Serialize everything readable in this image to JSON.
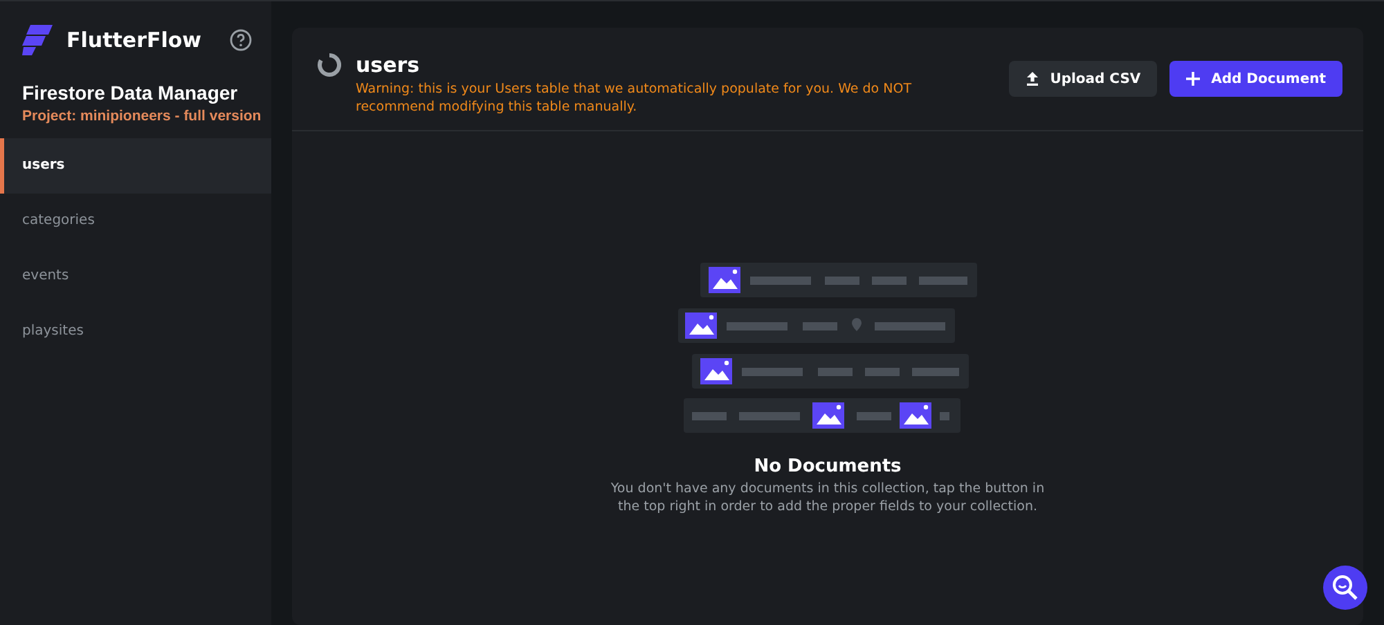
{
  "brand": {
    "name": "FlutterFlow"
  },
  "sidebar": {
    "title": "Firestore Data Manager",
    "project": "Project: minipioneers - full version",
    "items": [
      {
        "label": "users",
        "selected": true
      },
      {
        "label": "categories",
        "selected": false
      },
      {
        "label": "events",
        "selected": false
      },
      {
        "label": "playsites",
        "selected": false
      }
    ]
  },
  "collection": {
    "title": "users",
    "warning": "Warning: this is your Users table that we automatically populate for you. We do NOT recommend modifying this table manually."
  },
  "buttons": [
    {
      "label": "Upload CSV",
      "kind": "upload"
    },
    {
      "label": "Add Document",
      "kind": "add"
    }
  ],
  "empty_state": {
    "title": "No Documents",
    "message": "You don't have any documents in this collection, tap the button in the top right in order to add the proper fields to your collection."
  }
}
